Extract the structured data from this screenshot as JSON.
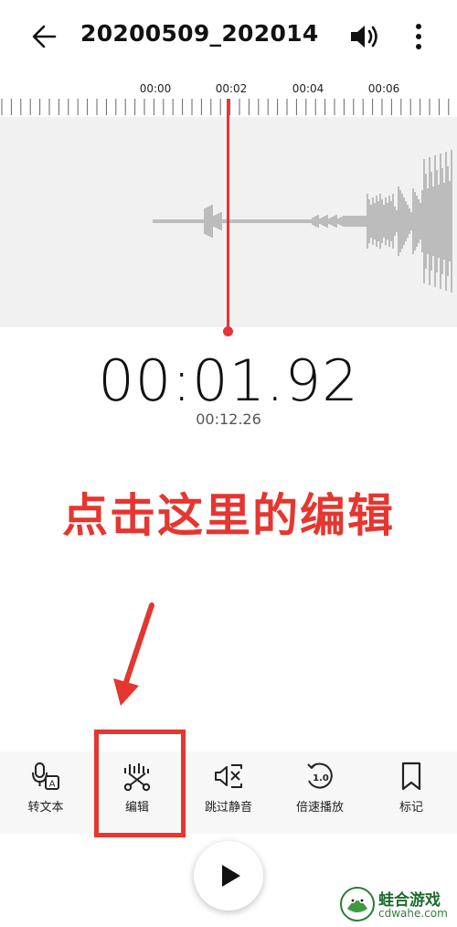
{
  "header": {
    "title": "20200509_202014",
    "back_icon": "arrow-left-icon",
    "speaker_icon": "speaker-icon",
    "more_icon": "more-vertical-icon"
  },
  "timeline": {
    "labels": [
      "00:00",
      "00:02",
      "00:04",
      "00:06"
    ]
  },
  "player": {
    "current_time": "00:01.92",
    "total_time": "00:12.26"
  },
  "annotation": {
    "text": "点击这里的编辑",
    "color": "#e5362f"
  },
  "toolbar": {
    "items": [
      {
        "label": "转文本",
        "icon": "speech-to-text-icon"
      },
      {
        "label": "编辑",
        "icon": "edit-scissors-icon"
      },
      {
        "label": "跳过静音",
        "icon": "skip-silence-icon"
      },
      {
        "label": "倍速播放",
        "icon": "playback-speed-icon"
      },
      {
        "label": "标记",
        "icon": "bookmark-icon"
      }
    ]
  },
  "play_button": {
    "icon": "play-icon"
  },
  "watermark": {
    "name": "蛙合游戏",
    "url": "cdwahe.com",
    "icon": "frog-logo-icon"
  },
  "colors": {
    "accent": "#e8333a",
    "annotation": "#e5362f",
    "waveform": "#9a9a9a"
  }
}
